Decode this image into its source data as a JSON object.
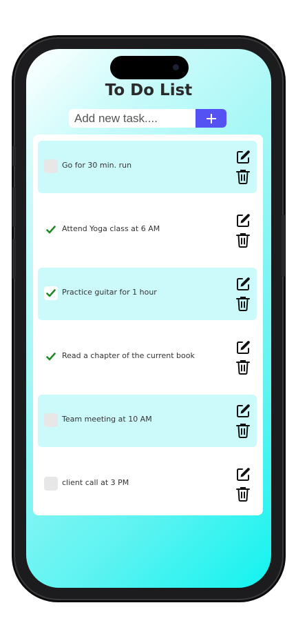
{
  "app": {
    "title": "To Do List"
  },
  "add_task": {
    "placeholder": "Add new task....",
    "value": "",
    "button_icon": "plus-icon"
  },
  "tasks": [
    {
      "text": "Go for 30 min. run",
      "completed": false,
      "style": "checkbox-empty"
    },
    {
      "text": "Attend Yoga class at 6 AM",
      "completed": true,
      "style": "check-mark"
    },
    {
      "text": "Practice guitar for 1 hour",
      "completed": true,
      "style": "check-in-box"
    },
    {
      "text": "Read a chapter of the current book",
      "completed": true,
      "style": "check-mark"
    },
    {
      "text": "Team meeting at 10 AM",
      "completed": false,
      "style": "checkbox-empty"
    },
    {
      "text": "client call at 3 PM",
      "completed": false,
      "style": "checkbox-empty"
    }
  ],
  "row_actions": {
    "edit_icon": "edit-icon",
    "delete_icon": "trash-icon"
  },
  "colors": {
    "accent": "#5452f2",
    "row_highlight": "#ccfafb",
    "check_green": "#1f8a2a",
    "title_text": "#2a2a2a",
    "gradient_end": "#12f3f0"
  }
}
